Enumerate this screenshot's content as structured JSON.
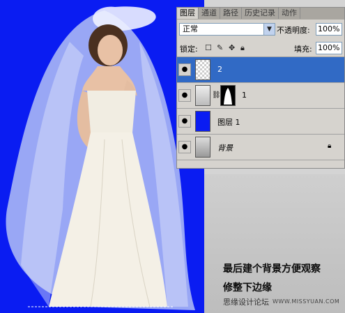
{
  "layers_panel": {
    "tabs": [
      "图层",
      "通道",
      "路径",
      "历史记录",
      "动作"
    ],
    "active_tab": "图层",
    "blend_mode": "正常",
    "opacity_label": "不透明度:",
    "opacity_value": "100%",
    "lock_label": "锁定:",
    "fill_label": "填充:",
    "fill_value": "100%",
    "layers": [
      {
        "name": "2",
        "selected": true,
        "thumb": "transparent"
      },
      {
        "name": "1",
        "selected": false,
        "thumb": "bride-with-mask"
      },
      {
        "name": "图层 1",
        "selected": false,
        "thumb": "blue-fill"
      },
      {
        "name": "背景",
        "selected": false,
        "thumb": "bride",
        "locked": true
      }
    ]
  },
  "canvas": {
    "background_color": "#0a1cf2"
  },
  "caption": {
    "line1": "最后建个背景方便观察",
    "line2": "修整下边缘"
  },
  "watermark": {
    "site": "思缘设计论坛",
    "url": "WWW.MISSYUAN.COM"
  },
  "icons": [
    "eye-icon",
    "lock-icon",
    "move-icon",
    "brush-icon",
    "chain-link-icon"
  ]
}
